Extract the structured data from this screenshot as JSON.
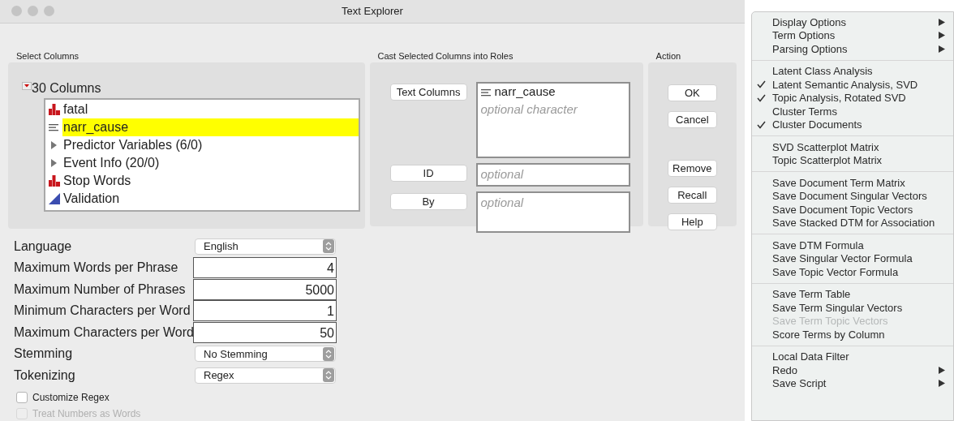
{
  "window": {
    "title": "Text Explorer"
  },
  "select_columns": {
    "label": "Select Columns",
    "header": "30 Columns",
    "items": [
      {
        "label": "fatal",
        "kind": "nominal",
        "selected": false
      },
      {
        "label": "narr_cause",
        "kind": "character",
        "selected": true
      },
      {
        "label": "Predictor Variables (6/0)",
        "kind": "group",
        "selected": false
      },
      {
        "label": "Event Info (20/0)",
        "kind": "group",
        "selected": false
      },
      {
        "label": "Stop Words",
        "kind": "nominal",
        "selected": false
      },
      {
        "label": "Validation",
        "kind": "continuous",
        "selected": false
      }
    ]
  },
  "options": [
    {
      "label": "Language",
      "kind": "dropdown",
      "value": "English"
    },
    {
      "label": "Maximum Words per Phrase",
      "kind": "number",
      "value": "4"
    },
    {
      "label": "Maximum Number of Phrases",
      "kind": "number",
      "value": "5000"
    },
    {
      "label": "Minimum Characters per Word",
      "kind": "number",
      "value": "1"
    },
    {
      "label": "Maximum Characters per Word",
      "kind": "number",
      "value": "50"
    },
    {
      "label": "Stemming",
      "kind": "dropdown",
      "value": "No Stemming"
    },
    {
      "label": "Tokenizing",
      "kind": "dropdown",
      "value": "Regex"
    }
  ],
  "checkboxes": [
    {
      "label": "Customize Regex",
      "checked": false,
      "disabled": false
    },
    {
      "label": "Treat Numbers as Words",
      "checked": false,
      "disabled": true
    }
  ],
  "roles": {
    "label": "Cast Selected Columns into Roles",
    "rows": [
      {
        "button": "Text Columns",
        "entries": [
          "narr_cause"
        ],
        "placeholder": "optional character"
      },
      {
        "button": "ID",
        "placeholder": "optional"
      },
      {
        "button": "By",
        "placeholder": "optional"
      }
    ]
  },
  "action": {
    "label": "Action",
    "buttons": [
      {
        "label": "OK"
      },
      {
        "label": "Cancel"
      },
      {
        "label": "Remove"
      },
      {
        "label": "Recall"
      },
      {
        "label": "Help"
      }
    ]
  },
  "menu": {
    "sections": [
      [
        {
          "label": "Display Options",
          "checked": false,
          "disabled": false,
          "submenu": true
        },
        {
          "label": "Term Options",
          "checked": false,
          "disabled": false,
          "submenu": true
        },
        {
          "label": "Parsing Options",
          "checked": false,
          "disabled": false,
          "submenu": true
        }
      ],
      [
        {
          "label": "Latent Class Analysis",
          "checked": false,
          "disabled": false,
          "submenu": false
        },
        {
          "label": "Latent Semantic Analysis, SVD",
          "checked": true,
          "disabled": false,
          "submenu": false
        },
        {
          "label": "Topic Analysis, Rotated SVD",
          "checked": true,
          "disabled": false,
          "submenu": false
        },
        {
          "label": "Cluster Terms",
          "checked": false,
          "disabled": false,
          "submenu": false
        },
        {
          "label": "Cluster Documents",
          "checked": true,
          "disabled": false,
          "submenu": false
        }
      ],
      [
        {
          "label": "SVD Scatterplot Matrix",
          "checked": false,
          "disabled": false,
          "submenu": false
        },
        {
          "label": "Topic Scatterplot Matrix",
          "checked": false,
          "disabled": false,
          "submenu": false
        }
      ],
      [
        {
          "label": "Save Document Term Matrix",
          "checked": false,
          "disabled": false,
          "submenu": false
        },
        {
          "label": "Save Document Singular Vectors",
          "checked": false,
          "disabled": false,
          "submenu": false
        },
        {
          "label": "Save Document Topic Vectors",
          "checked": false,
          "disabled": false,
          "submenu": false
        },
        {
          "label": "Save Stacked DTM for Association",
          "checked": false,
          "disabled": false,
          "submenu": false
        }
      ],
      [
        {
          "label": "Save DTM Formula",
          "checked": false,
          "disabled": false,
          "submenu": false
        },
        {
          "label": "Save Singular Vector Formula",
          "checked": false,
          "disabled": false,
          "submenu": false
        },
        {
          "label": "Save Topic Vector Formula",
          "checked": false,
          "disabled": false,
          "submenu": false
        }
      ],
      [
        {
          "label": "Save Term Table",
          "checked": false,
          "disabled": false,
          "submenu": false
        },
        {
          "label": "Save Term Singular Vectors",
          "checked": false,
          "disabled": false,
          "submenu": false
        },
        {
          "label": "Save Term Topic Vectors",
          "checked": false,
          "disabled": true,
          "submenu": false
        },
        {
          "label": "Score Terms by Column",
          "checked": false,
          "disabled": false,
          "submenu": false
        }
      ],
      [
        {
          "label": "Local Data Filter",
          "checked": false,
          "disabled": false,
          "submenu": false
        },
        {
          "label": "Redo",
          "checked": false,
          "disabled": false,
          "submenu": true
        },
        {
          "label": "Save Script",
          "checked": false,
          "disabled": false,
          "submenu": true
        }
      ]
    ]
  }
}
